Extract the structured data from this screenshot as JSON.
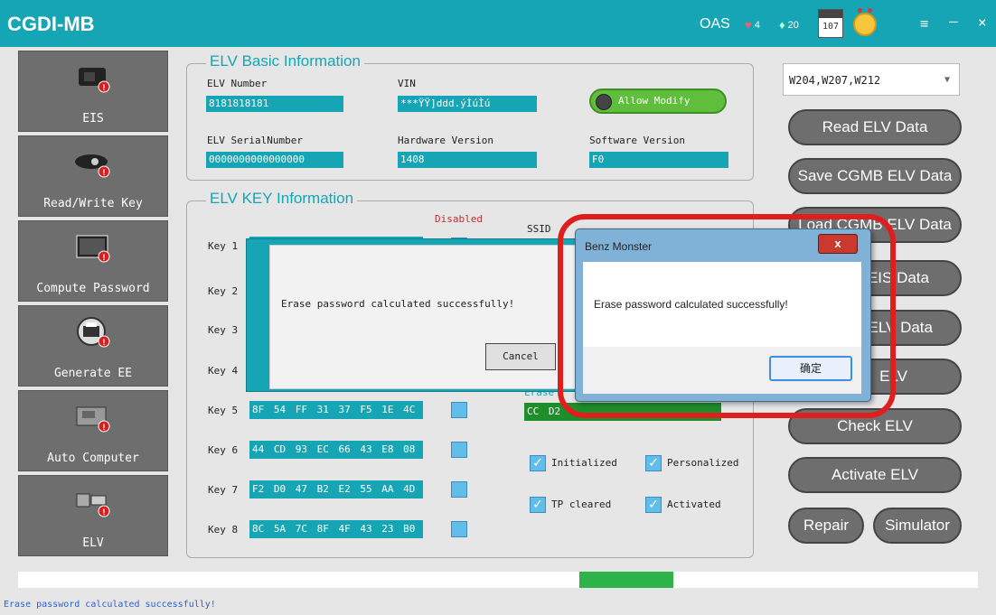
{
  "window": {
    "title": "CGDI-MB",
    "oas_label": "OAS",
    "hearts": "4",
    "gems": "20",
    "calendar_day": "107"
  },
  "sidebar": {
    "items": [
      {
        "label": "EIS"
      },
      {
        "label": "Read/Write Key"
      },
      {
        "label": "Compute Password"
      },
      {
        "label": "Generate EE"
      },
      {
        "label": "Auto Computer"
      },
      {
        "label": "ELV"
      }
    ]
  },
  "basic": {
    "title": "ELV Basic Information",
    "elv_number_label": "ELV Number",
    "elv_number": "8181818181",
    "vin_label": "VIN",
    "vin": "***ŸŸ]ddd.ýÌúÌú",
    "allow_modify": "Allow Modify",
    "serial_label": "ELV SerialNumber",
    "serial": "0000000000000000",
    "hw_label": "Hardware Version",
    "hw": "1408",
    "sw_label": "Software Version",
    "sw": "F0"
  },
  "keys": {
    "title": "ELV KEY Information",
    "disabled_label": "Disabled",
    "ssid_label": "SSID",
    "list": [
      {
        "label": "Key 1",
        "value": ""
      },
      {
        "label": "Key 2",
        "value": ""
      },
      {
        "label": "Key 3",
        "value": ""
      },
      {
        "label": "Key 4",
        "value": ""
      },
      {
        "label": "Key 5",
        "value": "8F 54 FF 31 37 F5 1E 4C"
      },
      {
        "label": "Key 6",
        "value": "44 CD 93 EC 66 43 E8 08"
      },
      {
        "label": "Key 7",
        "value": "F2 D0 47 B2 E2 55 AA 4D"
      },
      {
        "label": "Key 8",
        "value": "8C 5A 7C 8F 4F 43 23 B0"
      }
    ],
    "erase_label": "Erase",
    "erase_value": "CC D2",
    "status": {
      "initialized": "Initialized",
      "personalized": "Personalized",
      "tp_cleared": "TP cleared",
      "activated": "Activated"
    }
  },
  "right": {
    "model": "W204,W207,W212",
    "buttons": {
      "read": "Read  ELV Data",
      "save": "Save CGMB ELV Data",
      "load": "Load CGMB ELV Data",
      "eis": "EIS Data",
      "elv_data": "ELV Data",
      "elv": "ELV",
      "check": "Check ELV",
      "activate": "Activate ELV",
      "repair": "Repair",
      "simulator": "Simulator"
    }
  },
  "dialog_inner": {
    "message": "Erase password calculated successfully!",
    "cancel": "Cancel"
  },
  "dialog_popup": {
    "title": "Benz Monster",
    "message": "Erase password calculated successfully!",
    "ok": "确定",
    "close": "x"
  },
  "progress": {
    "fraction": 0.1
  },
  "status_bar": {
    "message": "Erase password calculated successfully!"
  },
  "colors": {
    "accent": "#16a5b5",
    "highlight": "#e01e1e"
  }
}
